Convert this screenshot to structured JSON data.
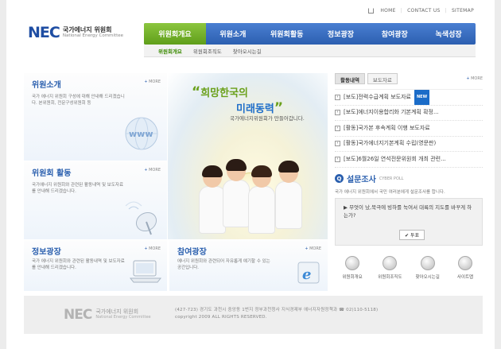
{
  "util": {
    "home": "HOME",
    "contact": "CONTACT US",
    "sitemap": "SITEMAP"
  },
  "logo": {
    "mark": "NEC",
    "korean": "국가에너지 위원회",
    "english": "National Energy Committee"
  },
  "nav": {
    "items": [
      "위원회개요",
      "위원소개",
      "위원회활동",
      "정보광장",
      "참여광장",
      "녹색성장"
    ],
    "active_index": 0
  },
  "subnav": {
    "items": [
      "위원회개요",
      "위원회조직도",
      "찾아오시는길"
    ]
  },
  "hero": {
    "quote_open": "“",
    "line1": "희망한국의",
    "line2": "미래동력",
    "quote_close": "”",
    "subtitle": "국가에너지위원회가 만들어갑니다."
  },
  "panels": [
    {
      "title": "위원소개",
      "more": "MORE",
      "desc": "국가 에너지 위원회 구성에 대해 안내해 드리겠습니다. 본위원회, 전문구성위원회 등"
    },
    {
      "title": "위원회 활동",
      "more": "MORE",
      "desc": "국가에너지 위원회와 관련된 활동내역 및 보도자료를 안내해 드리겠습니다."
    },
    {
      "title": "정보광장",
      "more": "MORE",
      "desc": "국가 에너지 위원회와 관련된 활동내역 및 보도자료를 안내해 드리겠습니다."
    },
    {
      "title": "참여광장",
      "more": "MORE",
      "desc": "에너지 위원회와 관련되어 자유롭게 얘기할 수 있는 공간입니다."
    }
  ],
  "news": {
    "tabs": [
      "활동내역",
      "보도자료"
    ],
    "more": "MORE",
    "items": [
      "[보도]전력수급계획 보도자료",
      "[보도]에너지이용합리화 기본계획 확정...",
      "[활동]국가본 후속계획 이행 보도자료",
      "[활동]국가에너지기본계획 수립(영문판)",
      "[보도]6월26일 연석전문위원회 개최 관련..."
    ],
    "new_badge": "NEW"
  },
  "poll": {
    "title": "설문조사",
    "title_en": "CYBER POLL",
    "desc": "국가 에너지 위원회에서 국민 여러분에게 설문조사를 합니다.",
    "question": "무엇이 났,북극에 빙하를 녹여서 대륙의 지도를 바꾸게 하는가?",
    "vote": "투표"
  },
  "quick_links": [
    "위원회개요",
    "위원회조직도",
    "찾아오시는길",
    "사이트맵"
  ],
  "footer": {
    "mark": "NEC",
    "korean": "국가에너지 위원회",
    "english": "National Energy Committee",
    "address": "(427-723) 경기도 과천시 중앙동 1번지 정부과천청사 지식경제부 에너지자원정책과  ☎ 02)110-5118)",
    "copyright": "copyright 2009  ALL RIGHTS RESERVED."
  },
  "colors": {
    "brand_blue": "#2a5fae",
    "nav_active_green": "#6aa01a",
    "accent_sky": "#3ab0e0"
  }
}
